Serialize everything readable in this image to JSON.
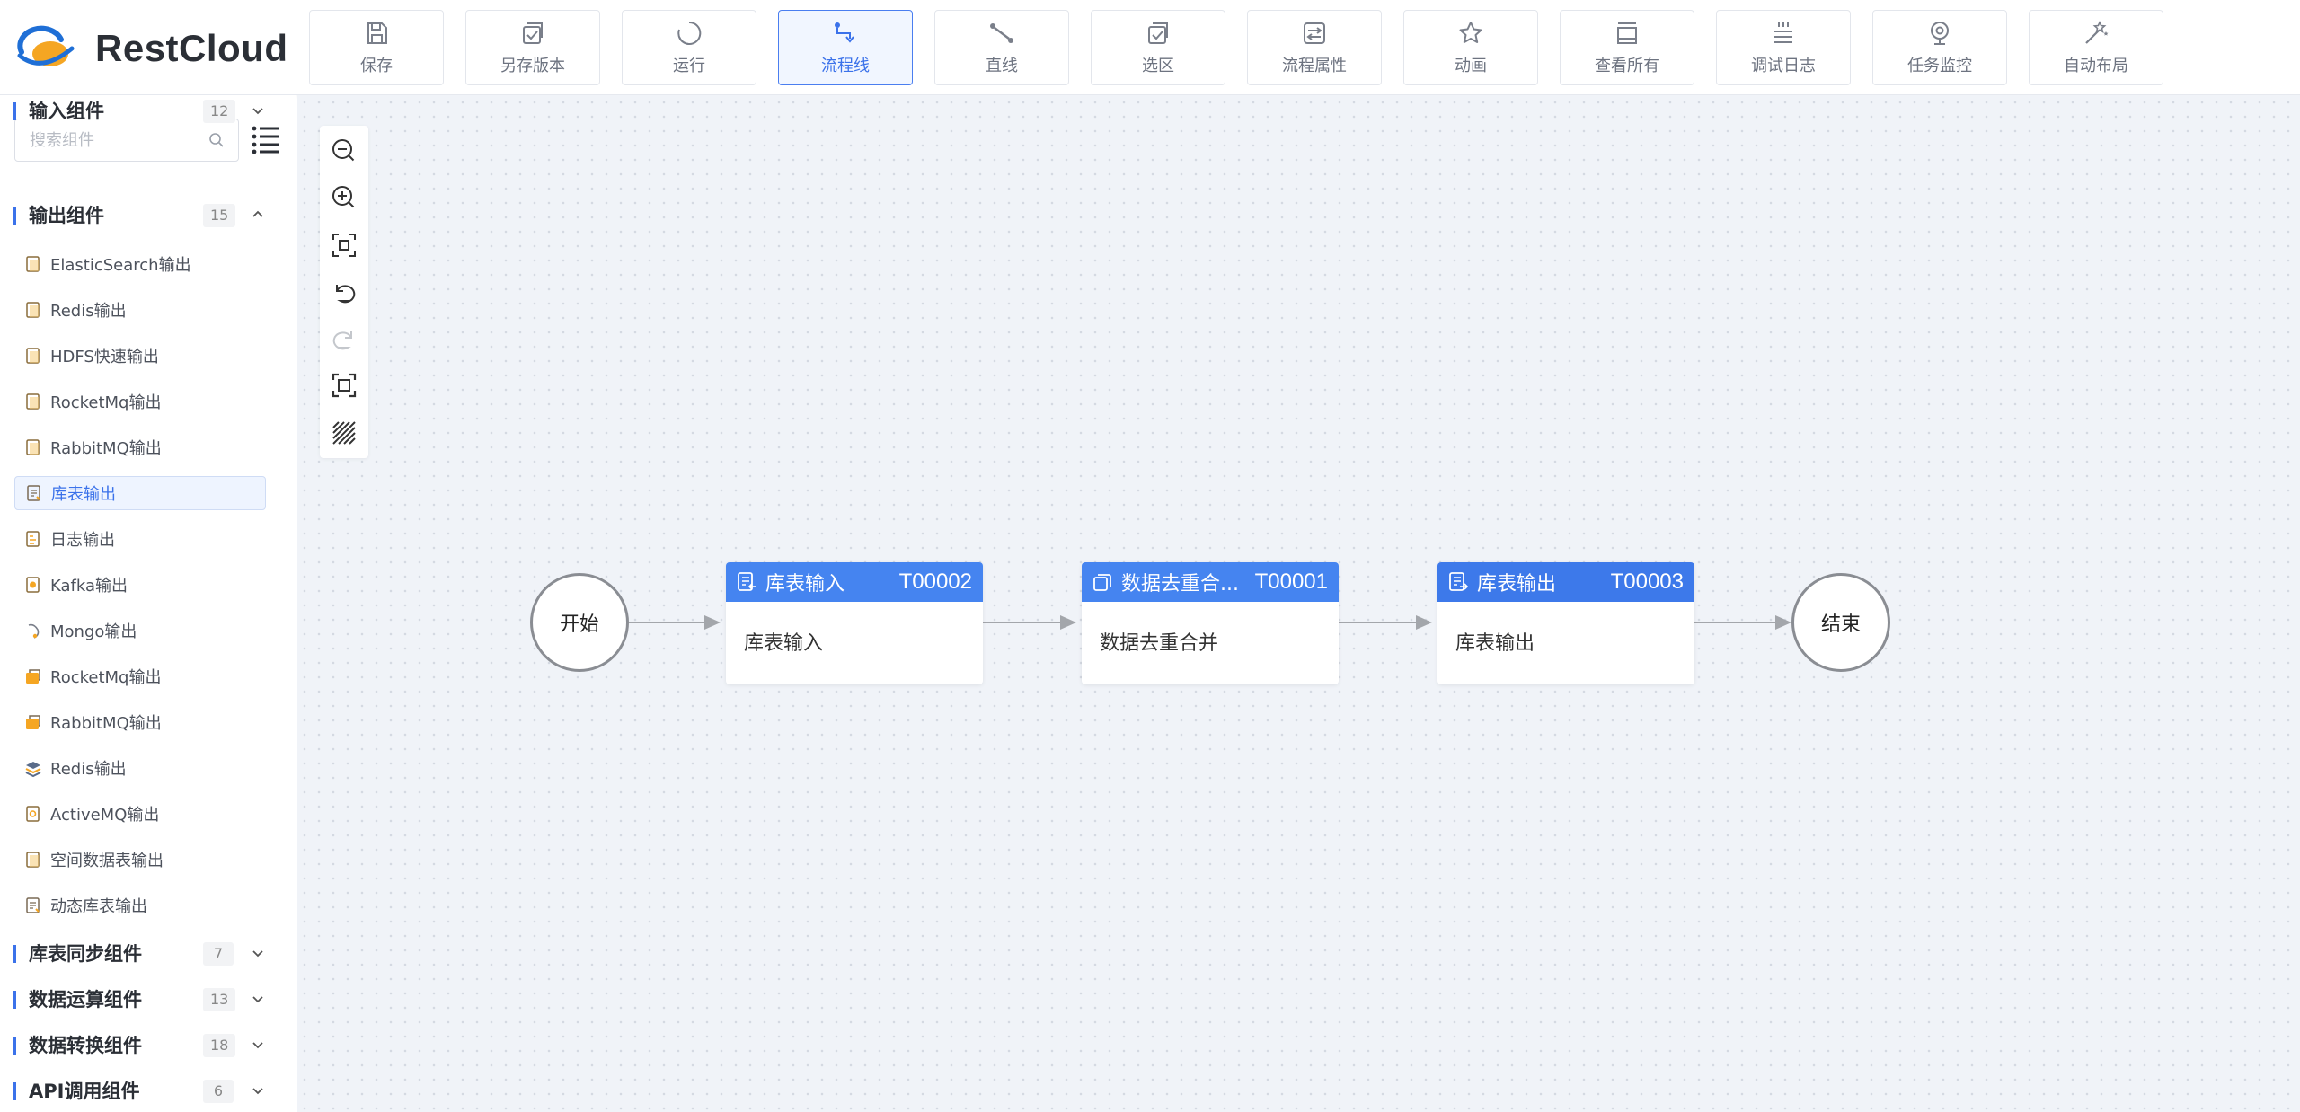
{
  "brand": {
    "name": "RestCloud",
    "colors": {
      "primary": "#3b72ea",
      "logo_orange": "#f5a623",
      "logo_blue": "#1f6fd6"
    }
  },
  "toolbar": [
    {
      "label": "保存",
      "icon": "save-icon"
    },
    {
      "label": "另存版本",
      "icon": "save-version-icon"
    },
    {
      "label": "运行",
      "icon": "run-icon"
    },
    {
      "label": "流程线",
      "icon": "flow-line-icon",
      "active": true
    },
    {
      "label": "直线",
      "icon": "straight-line-icon"
    },
    {
      "label": "选区",
      "icon": "selection-icon"
    },
    {
      "label": "流程属性",
      "icon": "flow-properties-icon"
    },
    {
      "label": "动画",
      "icon": "animation-icon"
    },
    {
      "label": "查看所有",
      "icon": "view-all-icon"
    },
    {
      "label": "调试日志",
      "icon": "debug-log-icon"
    },
    {
      "label": "任务监控",
      "icon": "task-monitor-icon"
    },
    {
      "label": "自动布局",
      "icon": "auto-layout-icon"
    }
  ],
  "sidebar": {
    "search_placeholder": "搜索组件",
    "groups": [
      {
        "title": "输入组件",
        "count": "12",
        "expanded": false
      },
      {
        "title": "输出组件",
        "count": "15",
        "expanded": true
      },
      {
        "title": "库表同步组件",
        "count": "7",
        "expanded": false
      },
      {
        "title": "数据运算组件",
        "count": "13",
        "expanded": false
      },
      {
        "title": "数据转换组件",
        "count": "18",
        "expanded": false
      },
      {
        "title": "API调用组件",
        "count": "6",
        "expanded": false
      }
    ],
    "output_items": [
      {
        "label": "ElasticSearch输出",
        "icon": "document-icon"
      },
      {
        "label": "Redis输出",
        "icon": "document-icon"
      },
      {
        "label": "HDFS快速输出",
        "icon": "document-icon"
      },
      {
        "label": "RocketMq输出",
        "icon": "document-icon"
      },
      {
        "label": "RabbitMQ输出",
        "icon": "document-icon"
      },
      {
        "label": "库表输出",
        "icon": "table-output-icon",
        "selected": true
      },
      {
        "label": "日志输出",
        "icon": "log-icon"
      },
      {
        "label": "Kafka输出",
        "icon": "kafka-icon"
      },
      {
        "label": "Mongo输出",
        "icon": "mongo-icon"
      },
      {
        "label": "RocketMq输出",
        "icon": "rocketmq-icon"
      },
      {
        "label": "RabbitMQ输出",
        "icon": "rabbitmq-icon"
      },
      {
        "label": "Redis输出",
        "icon": "redis-icon"
      },
      {
        "label": "ActiveMQ输出",
        "icon": "activemq-icon"
      },
      {
        "label": "空间数据表输出",
        "icon": "document-icon"
      },
      {
        "label": "动态库表输出",
        "icon": "table-output-icon"
      }
    ]
  },
  "canvas_tools": [
    {
      "icon": "zoom-out-icon"
    },
    {
      "icon": "zoom-in-icon"
    },
    {
      "icon": "fit-view-icon"
    },
    {
      "icon": "undo-icon"
    },
    {
      "icon": "redo-icon",
      "disabled": true
    },
    {
      "icon": "fullscreen-icon"
    },
    {
      "icon": "grid-pattern-icon"
    }
  ],
  "flow": {
    "start": {
      "label": "开始"
    },
    "end": {
      "label": "结束"
    },
    "tasks": [
      {
        "name": "库表输入",
        "id": "T00002",
        "body": "库表输入",
        "icon": "table-input-icon"
      },
      {
        "name": "数据去重合...",
        "id": "T00001",
        "body": "数据去重合并",
        "icon": "merge-icon"
      },
      {
        "name": "库表输出",
        "id": "T00003",
        "body": "库表输出",
        "icon": "table-output-icon"
      }
    ]
  }
}
